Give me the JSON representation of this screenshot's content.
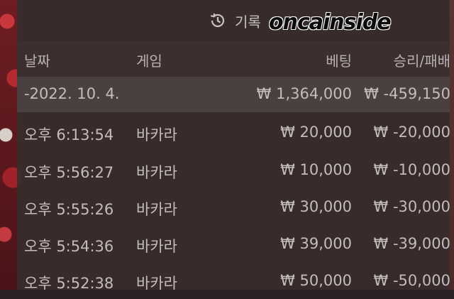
{
  "header": {
    "title": "기록",
    "watermark": "oncainside"
  },
  "columns": {
    "date": "날짜",
    "game": "게임",
    "bet": "베팅",
    "result": "승리/패배"
  },
  "summary": {
    "date": "-2022. 10. 4.",
    "game": "",
    "bet": "₩ 1,364,000",
    "result": "₩ -459,150"
  },
  "rows": [
    {
      "date": "오후 6:13:54",
      "game": "바카라",
      "bet": "₩ 20,000",
      "result": "₩ -20,000"
    },
    {
      "date": "오후 5:56:27",
      "game": "바카라",
      "bet": "₩ 10,000",
      "result": "₩ -10,000"
    },
    {
      "date": "오후 5:55:26",
      "game": "바카라",
      "bet": "₩ 30,000",
      "result": "₩ -30,000"
    },
    {
      "date": "오후 5:54:36",
      "game": "바카라",
      "bet": "₩ 39,000",
      "result": "₩ -39,000"
    },
    {
      "date": "오후 5:52:38",
      "game": "바카라",
      "bet": "₩ 50,000",
      "result": "₩ -50,000"
    }
  ],
  "colors": {
    "panel": "#382c2d",
    "header_bg": "#3b2f30",
    "summary_bg": "#4a4040",
    "text": "#c4bcbc"
  },
  "icons": {
    "history": "history-clock-icon"
  }
}
